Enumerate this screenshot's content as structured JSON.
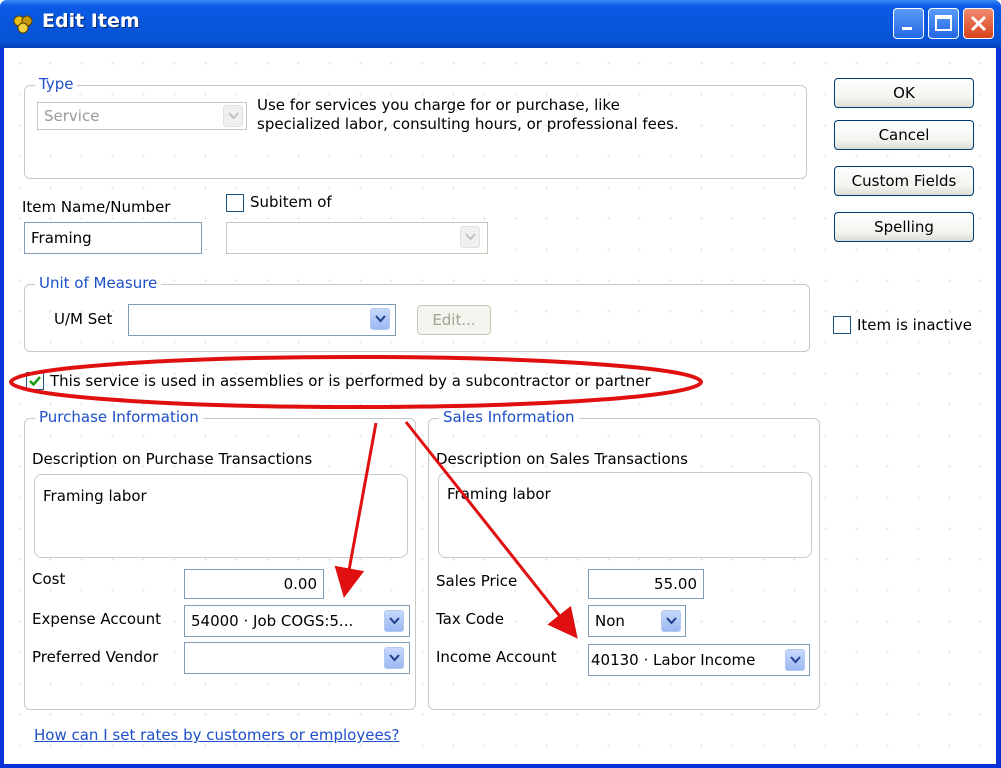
{
  "window": {
    "title": "Edit Item"
  },
  "type_group": {
    "legend": "Type",
    "selected": "Service",
    "description": "Use for services you charge for or purchase, like specialized labor, consulting hours, or professional fees."
  },
  "buttons": {
    "ok": "OK",
    "cancel": "Cancel",
    "custom_fields": "Custom Fields",
    "spelling": "Spelling"
  },
  "item": {
    "name_label": "Item Name/Number",
    "name_value": "Framing",
    "subitem_label": "Subitem of",
    "subitem_checked": false,
    "subitem_value": ""
  },
  "uom": {
    "legend": "Unit of Measure",
    "set_label": "U/M Set",
    "set_value": "",
    "edit_label": "Edit..."
  },
  "inactive": {
    "label": "Item is inactive",
    "checked": false
  },
  "assemblies": {
    "label": "This service is used in assemblies or is performed by a subcontractor or partner",
    "checked": true
  },
  "purchase": {
    "legend": "Purchase Information",
    "desc_label": "Description on Purchase Transactions",
    "desc_value": "Framing labor",
    "cost_label": "Cost",
    "cost_value": "0.00",
    "expense_label": "Expense Account",
    "expense_value": "54000 · Job COGS:5...",
    "vendor_label": "Preferred Vendor",
    "vendor_value": ""
  },
  "sales": {
    "legend": "Sales Information",
    "desc_label": "Description on Sales Transactions",
    "desc_value": "Framing labor",
    "price_label": "Sales Price",
    "price_value": "55.00",
    "tax_label": "Tax Code",
    "tax_value": "Non",
    "income_label": "Income Account",
    "income_value": "40130 · Labor Income"
  },
  "help_link": "How can I set rates by customers or employees?",
  "colors": {
    "title_bar": "#0756dc",
    "legend_text": "#1c4fc8",
    "annotation": "#e01010",
    "check": "#1a9a1a"
  }
}
